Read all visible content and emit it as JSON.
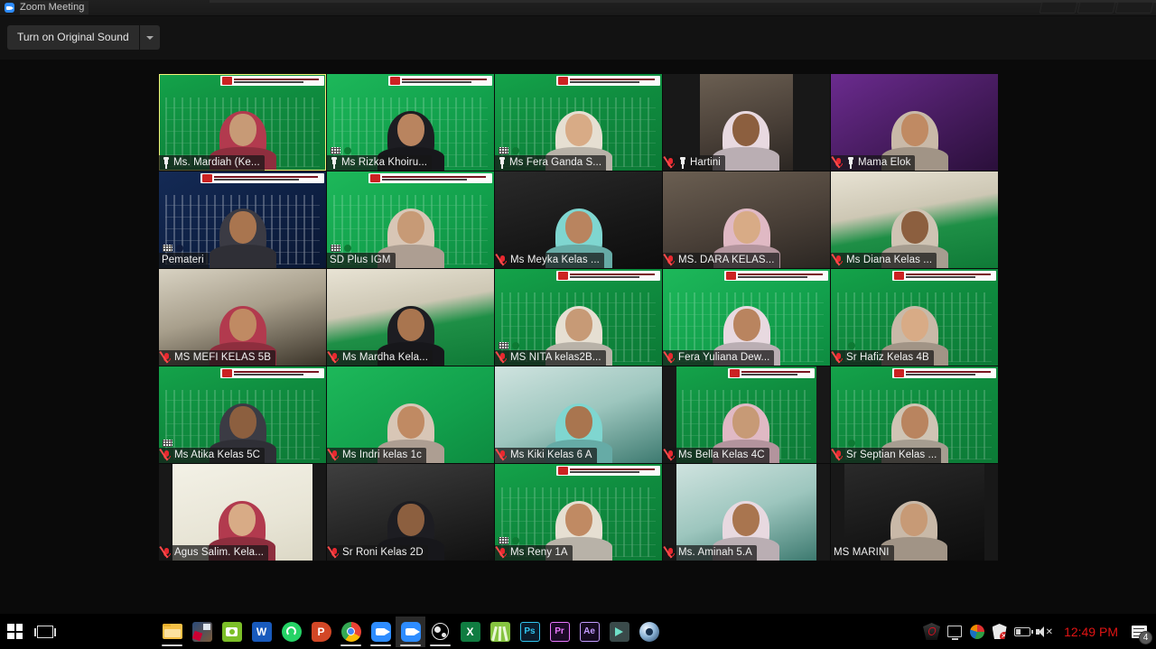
{
  "window": {
    "title": "Zoom Meeting",
    "app_icon": "zoom-icon",
    "controls": [
      "minimize-button",
      "maximize-button",
      "close-button"
    ]
  },
  "toolbar": {
    "original_sound_label": "Turn on Original Sound",
    "dropdown_icon": "chevron-down-icon"
  },
  "gallery": {
    "columns": 5,
    "rows": 5,
    "active_border_color": "#d9e840",
    "muted_icon_color": "#e8282f",
    "tiles": [
      {
        "name": "Ms. Mardiah (Ke...",
        "muted": false,
        "pinned": true,
        "active": true,
        "bg": "bg-green",
        "banner": true,
        "kbd": false,
        "dot": false
      },
      {
        "name": "Ms Rizka Khoiru...",
        "muted": false,
        "pinned": true,
        "active": false,
        "bg": "bg-greenlt",
        "banner": true,
        "kbd": true,
        "dot": true
      },
      {
        "name": "Ms Fera Ganda S...",
        "muted": false,
        "pinned": true,
        "active": false,
        "bg": "bg-green",
        "banner": true,
        "kbd": true,
        "dot": true
      },
      {
        "name": "Hartini",
        "muted": true,
        "pinned": true,
        "active": false,
        "bg": "bg-room",
        "banner": false,
        "kbd": false,
        "dot": false
      },
      {
        "name": "Mama Elok",
        "muted": true,
        "pinned": true,
        "active": false,
        "bg": "bg-purple",
        "banner": false,
        "kbd": false,
        "dot": false
      },
      {
        "name": "Pemateri",
        "muted": false,
        "pinned": false,
        "active": false,
        "bg": "bg-navy",
        "banner": true,
        "kbd": true,
        "dot": true
      },
      {
        "name": "SD Plus IGM",
        "muted": false,
        "pinned": false,
        "active": false,
        "bg": "bg-greenlt",
        "banner": true,
        "kbd": true,
        "dot": true
      },
      {
        "name": "Ms Meyka Kelas ...",
        "muted": true,
        "pinned": false,
        "active": false,
        "bg": "bg-dark",
        "banner": false,
        "kbd": false,
        "dot": false
      },
      {
        "name": "MS. DARA KELAS...",
        "muted": true,
        "pinned": false,
        "active": false,
        "bg": "bg-room",
        "banner": false,
        "kbd": false,
        "dot": false
      },
      {
        "name": "Ms Diana Kelas ...",
        "muted": true,
        "pinned": false,
        "active": false,
        "bg": "bg-classroom",
        "banner": false,
        "kbd": false,
        "dot": false
      },
      {
        "name": "MS MEFI KELAS 5B",
        "muted": true,
        "pinned": false,
        "active": false,
        "bg": "bg-office",
        "banner": false,
        "kbd": false,
        "dot": false
      },
      {
        "name": "Ms Mardha Kela...",
        "muted": true,
        "pinned": false,
        "active": false,
        "bg": "bg-classroom",
        "banner": false,
        "kbd": false,
        "dot": false
      },
      {
        "name": "MS NITA kelas2B...",
        "muted": true,
        "pinned": false,
        "active": false,
        "bg": "bg-green",
        "banner": true,
        "kbd": true,
        "dot": true
      },
      {
        "name": "Fera Yuliana Dew...",
        "muted": true,
        "pinned": false,
        "active": false,
        "bg": "bg-greenlt",
        "banner": true,
        "kbd": false,
        "dot": false
      },
      {
        "name": "Sr Hafiz Kelas 4B",
        "muted": true,
        "pinned": false,
        "active": false,
        "bg": "bg-green",
        "banner": true,
        "kbd": false,
        "dot": true
      },
      {
        "name": "Ms Atika Kelas 5C",
        "muted": true,
        "pinned": false,
        "active": false,
        "bg": "bg-green",
        "banner": true,
        "kbd": true,
        "dot": false
      },
      {
        "name": "Ms Indri kelas 1c",
        "muted": true,
        "pinned": false,
        "active": false,
        "bg": "bg-greenlt",
        "banner": false,
        "kbd": false,
        "dot": false
      },
      {
        "name": "Ms Kiki Kelas 6 A",
        "muted": true,
        "pinned": false,
        "active": false,
        "bg": "bg-teal",
        "banner": false,
        "kbd": false,
        "dot": false
      },
      {
        "name": "Ms Bella Kelas 4C",
        "muted": true,
        "pinned": false,
        "active": false,
        "bg": "bg-green",
        "banner": true,
        "kbd": false,
        "dot": false
      },
      {
        "name": "Sr Septian Kelas ...",
        "muted": true,
        "pinned": false,
        "active": false,
        "bg": "bg-green",
        "banner": true,
        "kbd": false,
        "dot": true
      },
      {
        "name": "Agus Salim. Kela...",
        "muted": true,
        "pinned": false,
        "active": false,
        "bg": "bg-cream",
        "banner": false,
        "kbd": false,
        "dot": false
      },
      {
        "name": "Sr Roni Kelas 2D",
        "muted": true,
        "pinned": false,
        "active": false,
        "bg": "bg-bw",
        "banner": false,
        "kbd": false,
        "dot": false
      },
      {
        "name": "Ms Reny 1A",
        "muted": true,
        "pinned": false,
        "active": false,
        "bg": "bg-green",
        "banner": true,
        "kbd": true,
        "dot": true
      },
      {
        "name": "Ms. Aminah 5.A",
        "muted": true,
        "pinned": false,
        "active": false,
        "bg": "bg-teal",
        "banner": false,
        "kbd": false,
        "dot": false
      },
      {
        "name": "MS MARINI",
        "muted": false,
        "pinned": false,
        "active": false,
        "bg": "bg-dark",
        "banner": false,
        "kbd": false,
        "dot": false
      }
    ]
  },
  "taskbar": {
    "items": [
      {
        "icon": "windows-start-icon",
        "label": "Start",
        "running": false,
        "active": false
      },
      {
        "icon": "task-view-icon",
        "label": "Task View",
        "running": false,
        "active": false
      },
      {
        "icon": "file-explorer-icon",
        "label": "File Explorer",
        "running": true,
        "active": false
      },
      {
        "icon": "photos-icon",
        "label": "Photos",
        "running": false,
        "active": false
      },
      {
        "icon": "camera-app-icon",
        "label": "Camera",
        "running": false,
        "active": false
      },
      {
        "icon": "word-icon",
        "label": "Word",
        "running": false,
        "active": false
      },
      {
        "icon": "whatsapp-icon",
        "label": "WhatsApp",
        "running": false,
        "active": false
      },
      {
        "icon": "powerpoint-icon",
        "label": "PowerPoint",
        "running": false,
        "active": false
      },
      {
        "icon": "chrome-icon",
        "label": "Google Chrome",
        "running": true,
        "active": false
      },
      {
        "icon": "zoom-icon",
        "label": "Zoom",
        "running": true,
        "active": false
      },
      {
        "icon": "zoom-meeting-icon",
        "label": "Zoom Meeting",
        "running": true,
        "active": true
      },
      {
        "icon": "obs-studio-icon",
        "label": "OBS Studio",
        "running": true,
        "active": false
      },
      {
        "icon": "excel-icon",
        "label": "Excel",
        "running": false,
        "active": false
      },
      {
        "icon": "wondershare-icon",
        "label": "Filmora",
        "running": false,
        "active": false
      },
      {
        "icon": "photoshop-icon",
        "label": "Photoshop",
        "running": false,
        "active": false
      },
      {
        "icon": "premiere-pro-icon",
        "label": "Premiere Pro",
        "running": false,
        "active": false
      },
      {
        "icon": "after-effects-icon",
        "label": "After Effects",
        "running": false,
        "active": false
      },
      {
        "icon": "teal-app-icon",
        "label": "Media Encoder",
        "running": false,
        "active": false
      },
      {
        "icon": "blue-orb-icon",
        "label": "Cortana",
        "running": false,
        "active": false
      }
    ],
    "tray": {
      "items": [
        {
          "icon": "rog-shield-icon",
          "label": "ROG Gaming Center"
        },
        {
          "icon": "display-icon",
          "label": "Display settings"
        },
        {
          "icon": "nvidia-icon",
          "label": "Graphics"
        },
        {
          "icon": "security-alert-icon",
          "label": "Security"
        },
        {
          "icon": "battery-icon",
          "label": "Battery"
        },
        {
          "icon": "speaker-muted-icon",
          "label": "Volume muted"
        }
      ],
      "clock": "12:49 PM",
      "clock_color": "#e01414",
      "notifications_icon": "notification-icon",
      "notifications_count": "4"
    }
  }
}
